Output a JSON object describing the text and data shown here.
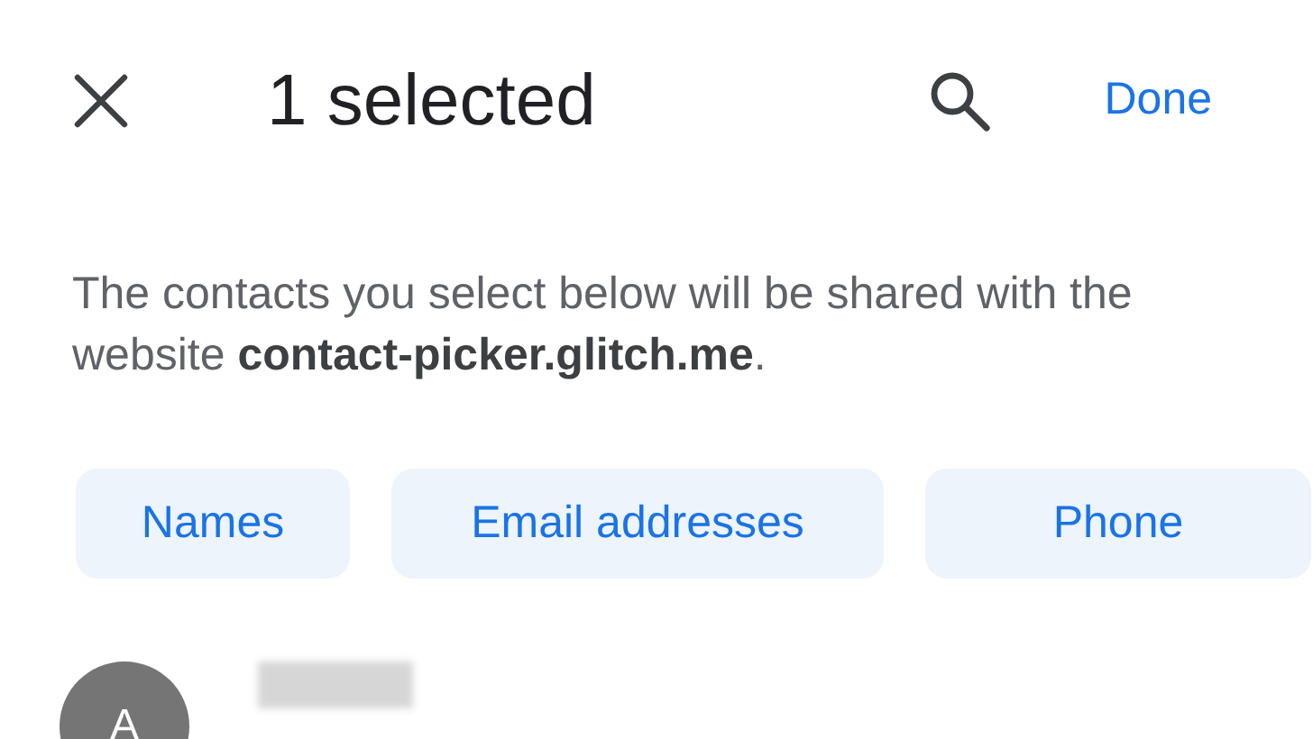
{
  "header": {
    "title": "1 selected",
    "done": "Done"
  },
  "description": "The contacts you select below will be shared with the website **contact-picker.glitch.me**.",
  "chips": [
    {
      "label": "Names",
      "selected": true
    },
    {
      "label": "Email addresses",
      "selected": true
    },
    {
      "label": "Phone",
      "selected": true
    }
  ],
  "contacts": [
    {
      "initial": "A"
    }
  ]
}
